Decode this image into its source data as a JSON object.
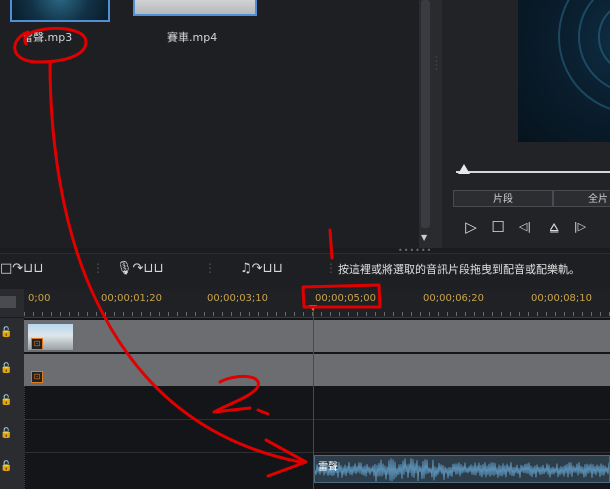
{
  "library": {
    "files": [
      {
        "name": "雷聲.mp3"
      },
      {
        "name": "賽車.mp4"
      }
    ]
  },
  "preview": {
    "tabs": {
      "clip": "片段",
      "full": "全片"
    },
    "controls": {
      "play": "▷",
      "stop": "☐",
      "prev_frame": "◁|",
      "split": "⩠",
      "next_frame": "|▷"
    }
  },
  "toolbar": {
    "hint": "按這裡或將選取的音訊片段拖曳到配音或配樂軌。"
  },
  "ruler": {
    "ticks": [
      "0;00",
      "00;00;01;20",
      "00;00;03;10",
      "00;00;05;00",
      "00;00;06;20",
      "00;00;08;10"
    ]
  },
  "timeline": {
    "audio_clip_label": "雷聲"
  },
  "annotation": {
    "step1": "1.",
    "step2": "2.",
    "color": "#e00000"
  },
  "colors": {
    "timecode": "#c9a44a",
    "playhead": "#d01010",
    "selection": "#4f8fd6",
    "fx": "#e07a1f"
  }
}
